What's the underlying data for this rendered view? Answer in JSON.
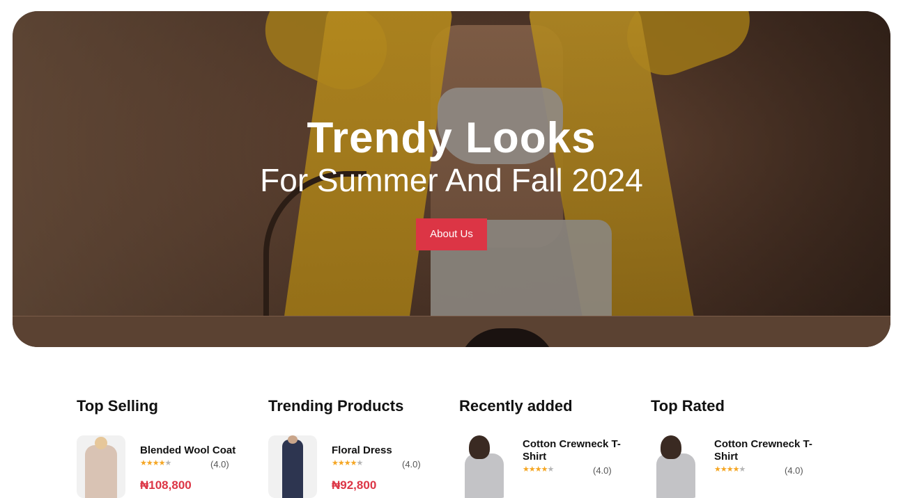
{
  "hero": {
    "title": "Trendy Looks",
    "subtitle": "For Summer And Fall 2024",
    "button_label": "About Us",
    "accent_color": "#dc3545"
  },
  "sections": [
    {
      "title": "Top Selling",
      "product": {
        "name": "Blended Wool Coat",
        "rating": "(4.0)",
        "price": "₦108,800",
        "icon": "coat-thumbnail"
      }
    },
    {
      "title": "Trending Products",
      "product": {
        "name": "Floral Dress",
        "rating": "(4.0)",
        "price": "₦92,800",
        "icon": "dress-thumbnail"
      }
    },
    {
      "title": "Recently added",
      "product": {
        "name": "Cotton Crewneck T-Shirt",
        "rating": "(4.0)",
        "icon": "tshirt-thumbnail"
      }
    },
    {
      "title": "Top Rated",
      "product": {
        "name": "Cotton Crewneck T-Shirt",
        "rating": "(4.0)",
        "icon": "tshirt-thumbnail"
      }
    }
  ],
  "stars": "★★★★",
  "star_half": "★"
}
